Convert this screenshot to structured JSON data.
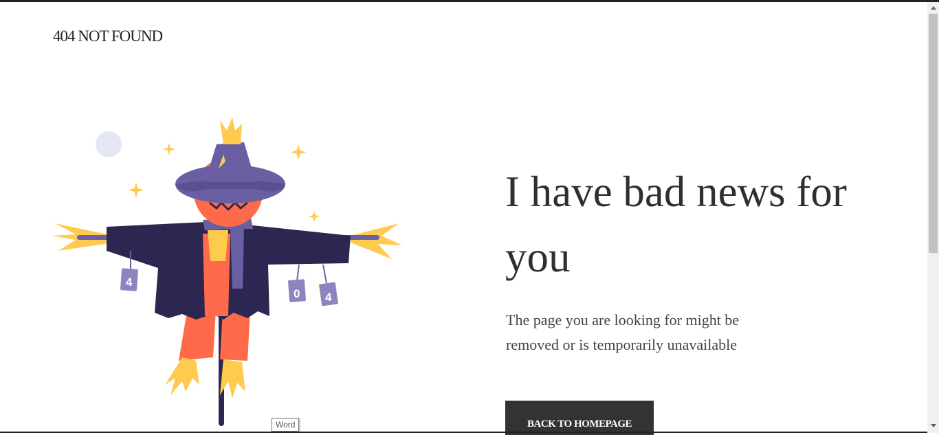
{
  "brand": {
    "text": "404 NOT FOUND"
  },
  "illustration": {
    "can_labels": [
      "4",
      "0",
      "4"
    ]
  },
  "main": {
    "headline": "I have bad news for you",
    "subtext": "The page you are looking for might be removed or is temporarily unavailable",
    "cta_label": "BACK TO HOMEPAGE"
  },
  "tooltip": {
    "text": "Word"
  },
  "colors": {
    "button_bg": "#333333",
    "pumpkin": "#ff6b4a",
    "hat": "#6b5fa3",
    "coat": "#2c2750",
    "straw": "#ffcb4f",
    "moon": "#e4e6f4"
  }
}
